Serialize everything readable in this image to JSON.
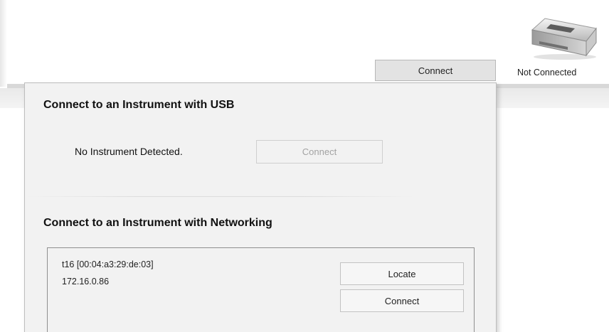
{
  "header": {
    "connect_label": "Connect",
    "status_label": "Not Connected",
    "instrument_icon": "instrument-device-icon"
  },
  "panel": {
    "usb": {
      "title": "Connect to an Instrument with USB",
      "status": "No Instrument Detected.",
      "connect_label": "Connect"
    },
    "network": {
      "title": "Connect to an Instrument with Networking",
      "instrument": {
        "name": "t16 [00:04:a3:29:de:03]",
        "ip": "172.16.0.86",
        "locate_label": "Locate",
        "connect_label": "Connect"
      }
    }
  },
  "colors": {
    "panel_background": "#f2f2f2",
    "button_background": "#e3e3e3",
    "disabled_text": "#a3a3a3"
  }
}
